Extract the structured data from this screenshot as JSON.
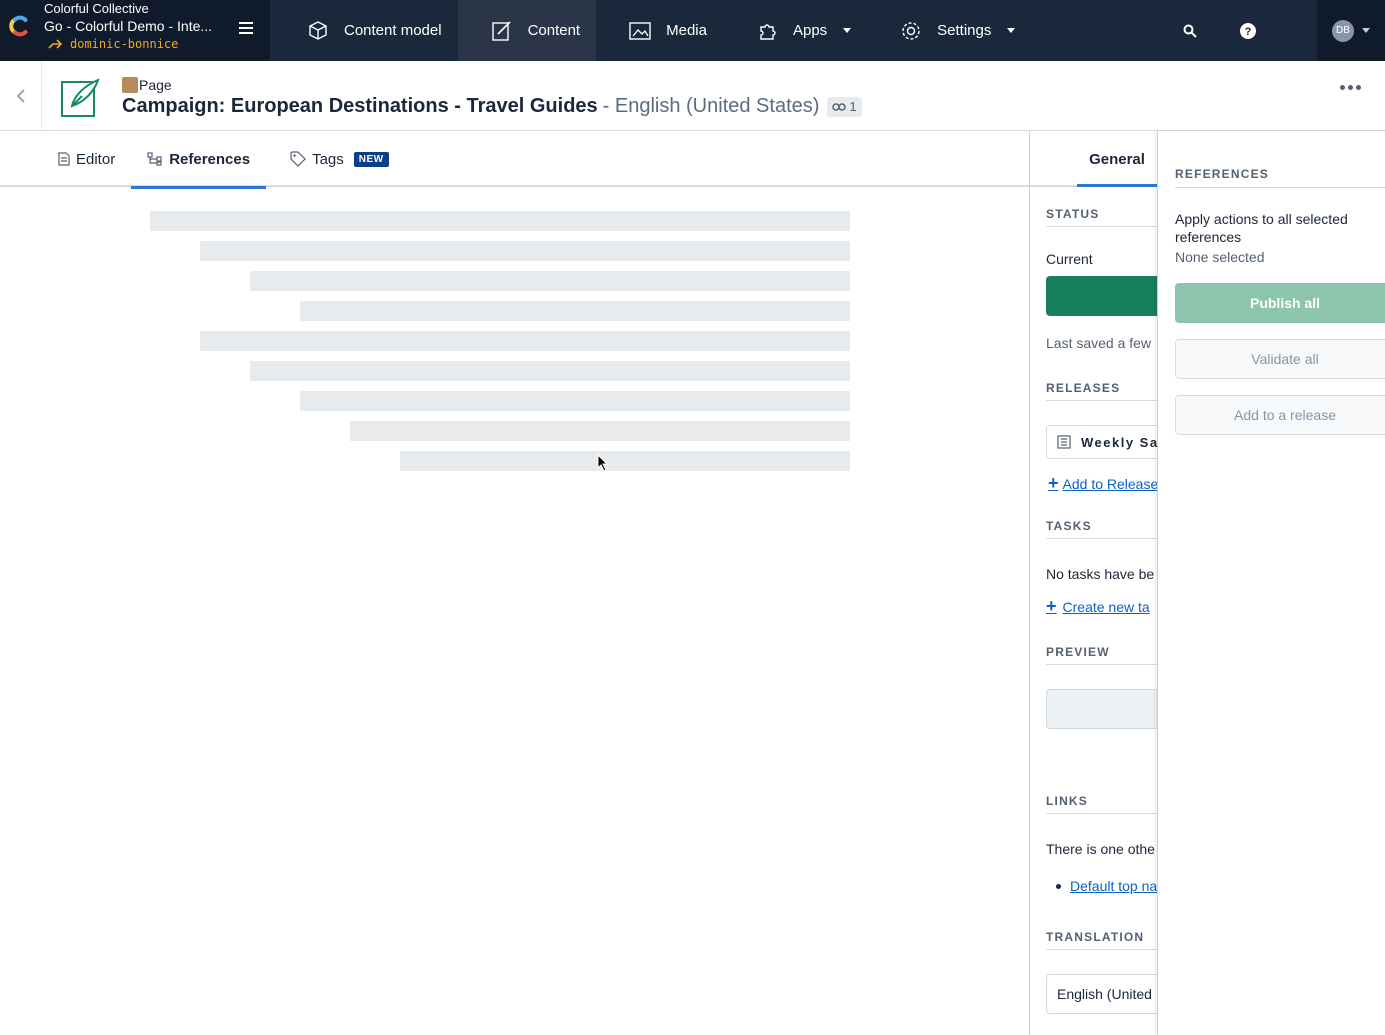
{
  "topbar": {
    "org_name": "Colorful Collective",
    "space_name": "Go - Colorful Demo - Inte...",
    "environment": "dominic-bonnice",
    "nav": [
      {
        "label": "Content model",
        "icon": "content-model-icon",
        "active": false,
        "dropdown": false
      },
      {
        "label": "Content",
        "icon": "content-icon",
        "active": true,
        "dropdown": false
      },
      {
        "label": "Media",
        "icon": "media-icon",
        "active": false,
        "dropdown": false
      },
      {
        "label": "Apps",
        "icon": "apps-icon",
        "active": false,
        "dropdown": true
      },
      {
        "label": "Settings",
        "icon": "gear-icon",
        "active": false,
        "dropdown": true
      }
    ],
    "avatar_initials": "DB"
  },
  "entry": {
    "content_type": "Page",
    "title": "Campaign: European Destinations - Travel Guides",
    "locale": "- English (United States)",
    "link_count": "1"
  },
  "tabs": [
    {
      "label": "Editor",
      "icon": "document-icon"
    },
    {
      "label": "References",
      "icon": "references-icon"
    },
    {
      "label": "Tags",
      "icon": "tag-icon",
      "badge": "NEW"
    }
  ],
  "sidebar": {
    "tab_label": "General",
    "status_heading": "STATUS",
    "current_label": "Current",
    "last_saved": "Last saved a few",
    "releases_heading": "RELEASES",
    "release_name": "Weekly Sa",
    "add_to_release": "Add to Release",
    "tasks_heading": "TASKS",
    "no_tasks": "No tasks have be",
    "create_task": "Create new ta",
    "preview_heading": "PREVIEW",
    "links_heading": "LINKS",
    "links_text": "There is one othe",
    "link_item": "Default top na",
    "translation_heading": "TRANSLATION",
    "translation_value": "English (United"
  },
  "references_panel": {
    "heading": "REFERENCES",
    "apply_text": "Apply actions to all selected references",
    "selection": "None selected",
    "publish_all": "Publish all",
    "validate_all": "Validate all",
    "add_to_release": "Add to a release"
  },
  "colors": {
    "topbar_bg": "#1b273a",
    "accent_blue": "#2e75d4",
    "status_green": "#17805b",
    "publish_disabled": "#8cc4ae",
    "env_orange": "#f5a623"
  }
}
